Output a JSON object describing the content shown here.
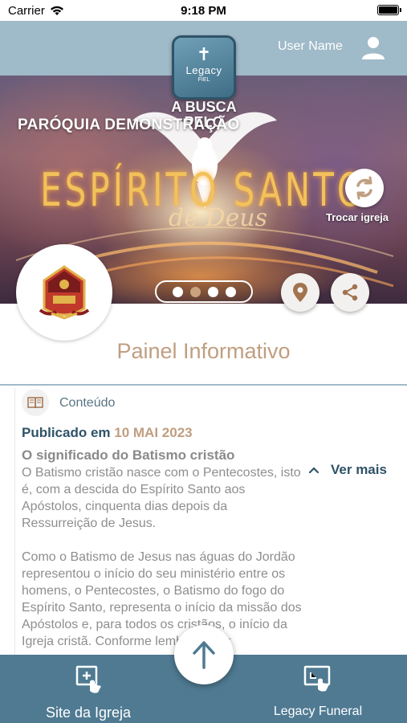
{
  "status_bar": {
    "carrier": "Carrier",
    "time": "9:18 PM"
  },
  "header": {
    "user_name": "User Name"
  },
  "logo": {
    "title": "Legacy",
    "subtitle": "FIEL"
  },
  "banner": {
    "parish_name": "PARÓQUIA DEMONSTRAÇÃO",
    "headline": "A BUSCA PELO",
    "main_title": "ESPÍRITO SANTO",
    "script_title": "de Deus",
    "change_church_label": "Trocar igreja"
  },
  "carousel": {
    "count": 4,
    "active_index": 1
  },
  "section_title": "Painel Informativo",
  "post": {
    "category": "Conteúdo",
    "published_prefix": "Publicado em",
    "published_date": "10 MAI 2023",
    "title": "O significado do Batismo cristão",
    "body": "O Batismo cristão nasce com o Pentecostes, isto é, com a descida do Espírito Santo aos Apóstolos, cinquenta dias depois da Ressurreição de Jesus.\n\nComo o Batismo de Jesus nas águas do Jordão representou o início do seu ministério entre os homens, o Pentecostes, o Batismo do fogo do Espírito Santo, representa o início da missão dos Apóstolos e, para todos os cristãos, o início da Igreja cristã. Conforme lembrado por",
    "see_more_label": "Ver mais"
  },
  "bottom_nav": {
    "left_label": "Site da Igreja",
    "right_label": "Legacy Funeral"
  },
  "colors": {
    "header": "#9fbac8",
    "bottom_bar": "#4f7a92",
    "accent": "#c09e80",
    "primary_text": "#2f5368"
  }
}
